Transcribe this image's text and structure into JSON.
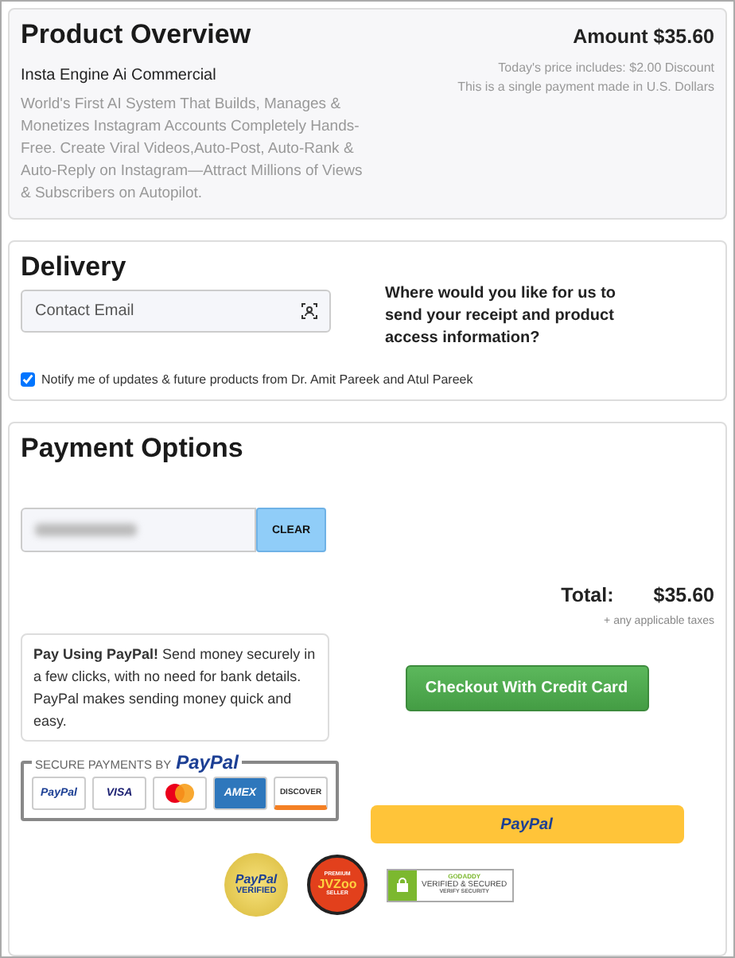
{
  "overview": {
    "title": "Product Overview",
    "amount": "Amount $35.60",
    "product": "Insta Engine Ai Commercial",
    "description": "World's First AI System That Builds, Manages & Monetizes Instagram Accounts Completely Hands-Free. Create Viral Videos,Auto-Post, Auto-Rank & Auto-Reply on Instagram—Attract Millions of Views & Subscribers on Autopilot.",
    "notes": [
      "Today's price includes: $2.00 Discount",
      "This is a single payment made in U.S. Dollars"
    ]
  },
  "delivery": {
    "title": "Delivery",
    "email": {
      "placeholder": "Contact Email"
    },
    "question": "Where would you like for us to send your receipt and product access information?",
    "notify": {
      "label": "Notify me of updates & future products from Dr. Amit Pareek and Atul Pareek",
      "checked": true
    }
  },
  "payment": {
    "title": "Payment Options",
    "coupon": {
      "redacted": true
    },
    "clear_button": "CLEAR",
    "total_label": "Total:",
    "total": "$35.60",
    "taxes": "+ any applicable taxes",
    "paypal_info": "**Pay Using PayPal!** Send money securely in a few clicks, with no need for bank details. PayPal makes sending money quick and easy.",
    "secure_label": "SECURE PAYMENTS BY",
    "secure_brand": "PayPal",
    "cards": [
      {
        "kind": "paypal",
        "label": "PayPal"
      },
      {
        "kind": "visa",
        "label": "VISA"
      },
      {
        "kind": "mastercard"
      },
      {
        "kind": "amex",
        "label": "AMEX"
      },
      {
        "kind": "discover",
        "label": "DISCOVER"
      }
    ],
    "checkout_button": "Checkout With Credit Card",
    "paypal_button": "PayPal",
    "seals": [
      {
        "kind": "paypal",
        "lines": [
          "PayPal",
          "VERIFIED"
        ]
      },
      {
        "kind": "jvzoo",
        "lines": [
          "PREMIUM",
          "JVZoo",
          "SELLER"
        ]
      },
      {
        "kind": "godaddy",
        "lines": [
          "GODADDY",
          "VERIFIED & SECURED",
          "VERIFY SECURITY"
        ]
      }
    ]
  }
}
